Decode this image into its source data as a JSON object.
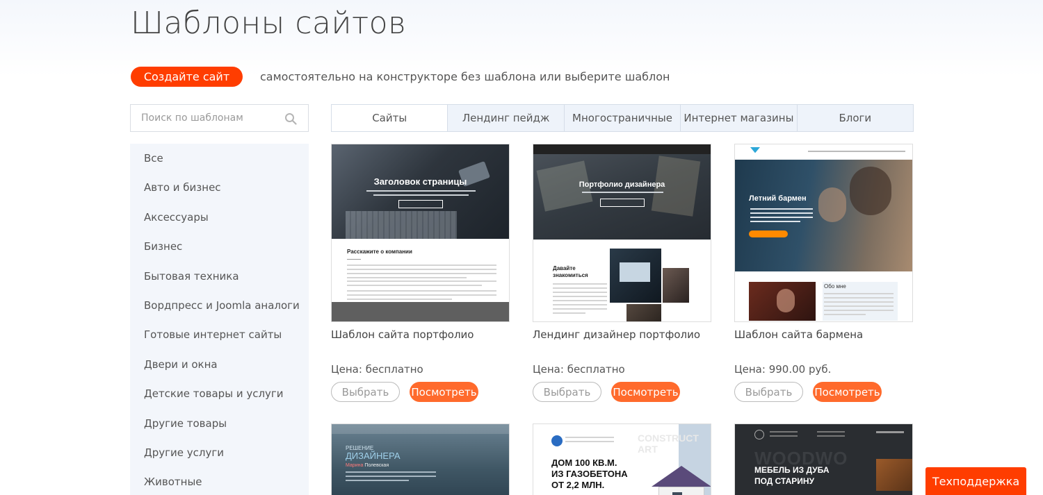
{
  "page": {
    "title": "Шаблоны сайтов",
    "create_button": "Создайте сайт",
    "create_text": "самостоятельно на конструкторе без шаблона или выберите шаблон"
  },
  "search": {
    "placeholder": "Поиск по шаблонам"
  },
  "sidebar": {
    "items": [
      "Все",
      "Авто и бизнес",
      "Аксессуары",
      "Бизнес",
      "Бытовая техника",
      "Вордпресс и Joomla аналоги",
      "Готовые интернет сайты",
      "Двери и окна",
      "Детские товары и услуги",
      "Другие товары",
      "Другие услуги",
      "Животные"
    ]
  },
  "tabs": [
    "Сайты",
    "Лендинг пейдж",
    "Многостраничные",
    "Интернет магазины",
    "Блоги"
  ],
  "cards": [
    {
      "name": "Шаблон сайта портфолио",
      "price": "Цена: бесплатно",
      "select_label": "Выбрать",
      "view_label": "Посмотреть",
      "preview": {
        "hero": "Заголовок страницы",
        "section": "Расскажите о компании"
      }
    },
    {
      "name": "Лендинг дизайнер портфолио",
      "price": "Цена: бесплатно",
      "select_label": "Выбрать",
      "view_label": "Посмотреть",
      "preview": {
        "hero": "Портфолио дизайнера",
        "section_line1": "Давайте",
        "section_line2": "знакомиться"
      }
    },
    {
      "name": "Шаблон сайта бармена",
      "price": "Цена: 990.00 руб.",
      "select_label": "Выбрать",
      "view_label": "Посмотреть",
      "preview": {
        "hero": "Летний бармен",
        "section": "Обо мне"
      }
    },
    {
      "preview": {
        "hero_line1": "РЕШЕНИЕ",
        "hero_line2": "ДИЗАЙНЕРА",
        "subtitle_accent": "Марина",
        "subtitle_rest": " Полевская"
      }
    },
    {
      "preview": {
        "bg_text": "CONSTRUCT ART",
        "hero_line1": "ДОМ 100 КВ.М.",
        "hero_line2": "ИЗ ГАЗОБЕТОНА",
        "hero_line3": "ОТ 2,2 МЛН."
      }
    },
    {
      "preview": {
        "bg_text": "WOODWO",
        "hero_line1": "МЕБЕЛЬ ИЗ ДУБА",
        "hero_line2": "ПОД СТАРИНУ"
      }
    }
  ],
  "support_button": "Техподдержка",
  "colors": {
    "accent": "#ff3d00",
    "view_button": "#ff6a2c",
    "sidebar_bg": "#f3f6fb",
    "tab_bg": "#eef3fa"
  }
}
